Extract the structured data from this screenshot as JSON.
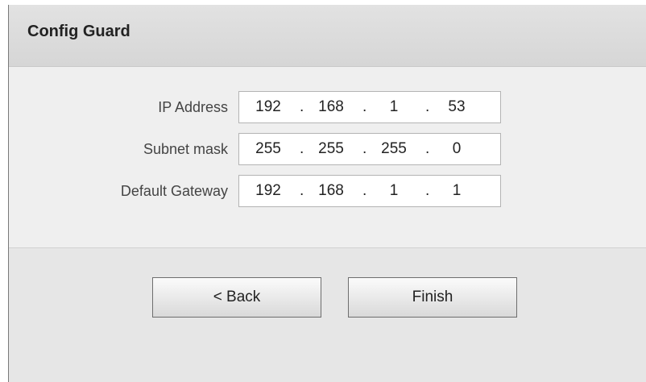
{
  "dialog": {
    "title": "Config Guard"
  },
  "fields": [
    {
      "label": "IP Address",
      "octets": [
        "192",
        "168",
        "1",
        "53"
      ]
    },
    {
      "label": "Subnet mask",
      "octets": [
        "255",
        "255",
        "255",
        "0"
      ]
    },
    {
      "label": "Default Gateway",
      "octets": [
        "192",
        "168",
        "1",
        "1"
      ]
    }
  ],
  "separator": ".",
  "buttons": {
    "back_label": "< Back",
    "finish_label": "Finish"
  }
}
